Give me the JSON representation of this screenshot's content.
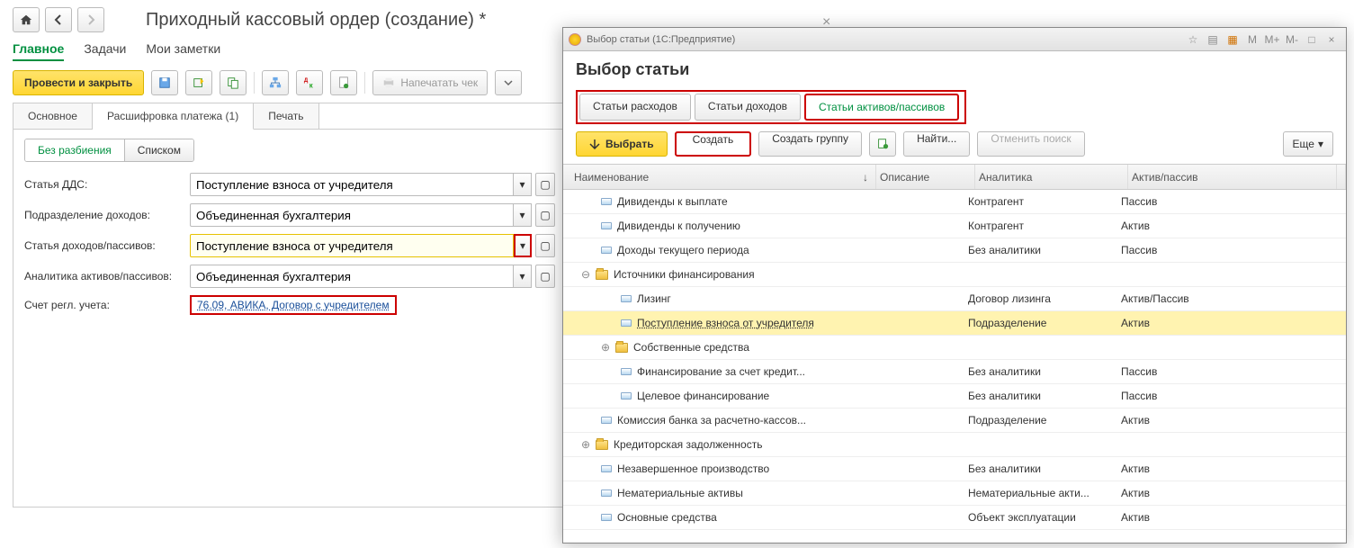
{
  "main": {
    "title": "Приходный кассовый ордер (создание) *",
    "nav": {
      "tab1": "Главное",
      "tab2": "Задачи",
      "tab3": "Мои заметки"
    },
    "save_label": "Провести и закрыть",
    "print_label": "Напечатать чек",
    "tabs": {
      "t1": "Основное",
      "t2": "Расшифровка платежа (1)",
      "t3": "Печать"
    },
    "toggle": {
      "a": "Без разбиения",
      "b": "Списком"
    },
    "rows": {
      "r1_label": "Статья ДДС:",
      "r1_val": "Поступление взноса от учредителя",
      "r2_label": "Подразделение доходов:",
      "r2_val": "Объединенная бухгалтерия",
      "r3_label": "Статья доходов/пассивов:",
      "r3_val": "Поступление взноса от учредителя",
      "r4_label": "Аналитика активов/пассивов:",
      "r4_val": "Объединенная бухгалтерия",
      "r5_label": "Счет регл. учета:",
      "r5_val": "76.09, АВИКА, Договор с учредителем"
    }
  },
  "modal": {
    "titlebar": "Выбор статьи  (1С:Предприятие)",
    "heading": "Выбор статьи",
    "cats": {
      "c1": "Статьи расходов",
      "c2": "Статьи доходов",
      "c3": "Статьи активов/пассивов"
    },
    "btns": {
      "select": "Выбрать",
      "create": "Создать",
      "group": "Создать группу",
      "find": "Найти...",
      "cancel": "Отменить поиск",
      "more": "Еще"
    },
    "cols": {
      "c1": "Наименование",
      "c2": "Описание",
      "c3": "Аналитика",
      "c4": "Актив/пассив"
    },
    "rows": [
      {
        "indent": 1,
        "type": "item",
        "name": "Дивиденды к выплате",
        "anal": "Контрагент",
        "ap": "Пассив"
      },
      {
        "indent": 1,
        "type": "item",
        "name": "Дивиденды к получению",
        "anal": "Контрагент",
        "ap": "Актив"
      },
      {
        "indent": 1,
        "type": "item",
        "name": "Доходы текущего периода",
        "anal": "Без аналитики",
        "ap": "Пассив"
      },
      {
        "indent": 0,
        "type": "folder",
        "exp": "⊖",
        "name": "Источники финансирования",
        "anal": "",
        "ap": ""
      },
      {
        "indent": 2,
        "type": "item",
        "name": "Лизинг",
        "anal": "Договор лизинга",
        "ap": "Актив/Пассив"
      },
      {
        "indent": 2,
        "type": "item",
        "name": "Поступление взноса от учредителя",
        "anal": "Подразделение",
        "ap": "Актив",
        "sel": true
      },
      {
        "indent": 1,
        "type": "folder",
        "exp": "⊕",
        "name": "Собственные средства",
        "anal": "",
        "ap": ""
      },
      {
        "indent": 2,
        "type": "item",
        "name": "Финансирование за счет кредит...",
        "anal": "Без аналитики",
        "ap": "Пассив"
      },
      {
        "indent": 2,
        "type": "item",
        "name": "Целевое финансирование",
        "anal": "Без аналитики",
        "ap": "Пассив"
      },
      {
        "indent": 1,
        "type": "item",
        "name": "Комиссия банка за расчетно-кассов...",
        "anal": "Подразделение",
        "ap": "Актив"
      },
      {
        "indent": 0,
        "type": "folder",
        "exp": "⊕",
        "name": "Кредиторская задолженность",
        "anal": "",
        "ap": ""
      },
      {
        "indent": 1,
        "type": "item",
        "name": "Незавершенное производство",
        "anal": "Без аналитики",
        "ap": "Актив"
      },
      {
        "indent": 1,
        "type": "item",
        "name": "Нематериальные активы",
        "anal": "Нематериальные акти...",
        "ap": "Актив"
      },
      {
        "indent": 1,
        "type": "item",
        "name": "Основные средства",
        "anal": "Объект эксплуатации",
        "ap": "Актив"
      }
    ]
  }
}
